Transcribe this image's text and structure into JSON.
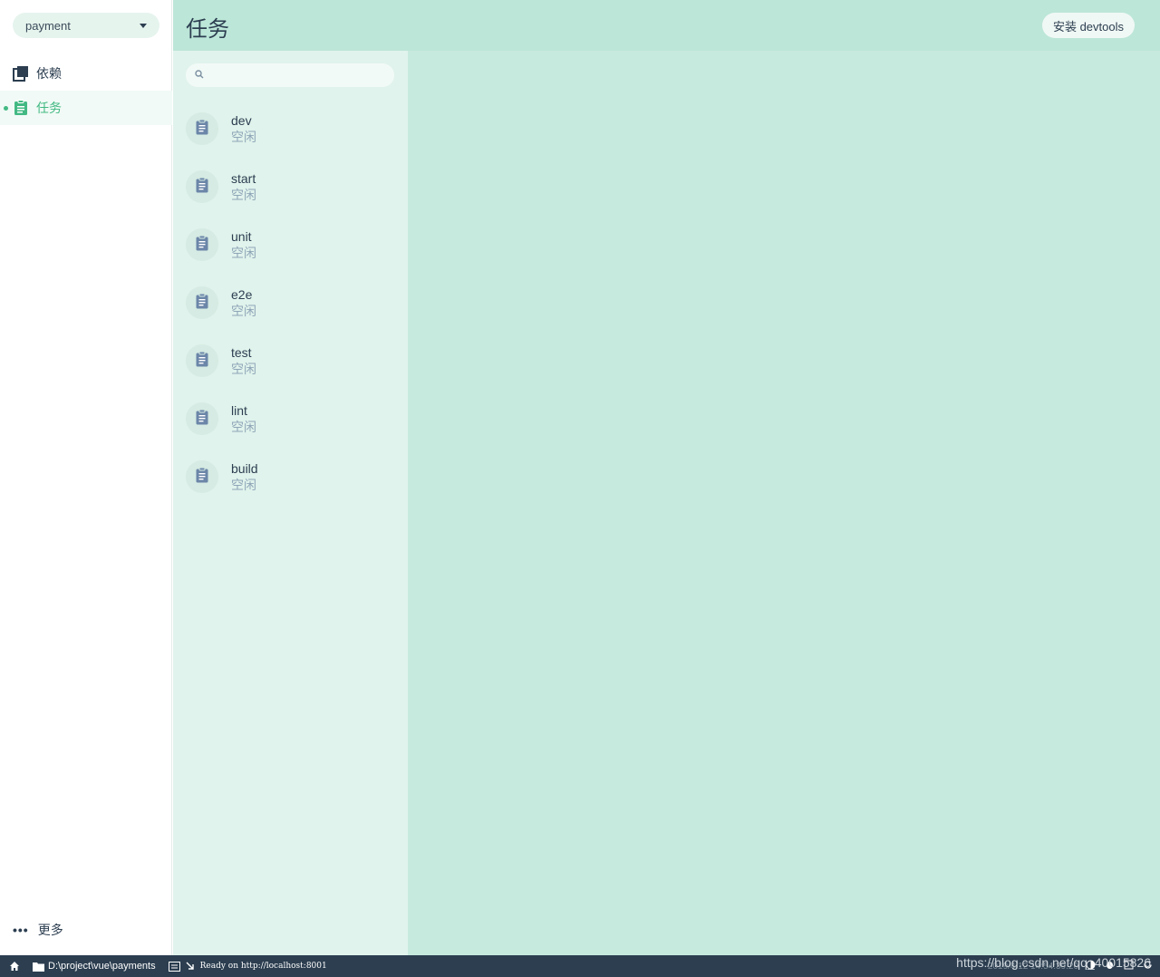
{
  "sidebar": {
    "project": "payment",
    "items": [
      {
        "label": "依赖",
        "icon": "dependencies-icon"
      },
      {
        "label": "任务",
        "icon": "tasks-icon",
        "active": true
      }
    ],
    "more_label": "更多"
  },
  "header": {
    "title": "任务",
    "install_button": "安装 devtools"
  },
  "search": {
    "placeholder": ""
  },
  "tasks": [
    {
      "name": "dev",
      "status": "空闲"
    },
    {
      "name": "start",
      "status": "空闲"
    },
    {
      "name": "unit",
      "status": "空闲"
    },
    {
      "name": "e2e",
      "status": "空闲"
    },
    {
      "name": "test",
      "status": "空闲"
    },
    {
      "name": "lint",
      "status": "空闲"
    },
    {
      "name": "build",
      "status": "空闲"
    }
  ],
  "statusbar": {
    "path": "D:\\project\\vue\\payments",
    "log": "Ready on http://localhost:8001",
    "date": "2019/4/12 14:54:39.20",
    "watermark": "https://blog.csdn.net/qq_40015826"
  },
  "colors": {
    "accent": "#42b983",
    "header_bg": "#bce6d8",
    "panel_bg": "#e0f3ec",
    "main_bg": "#c7eade",
    "statusbar_bg": "#2c3e50"
  }
}
